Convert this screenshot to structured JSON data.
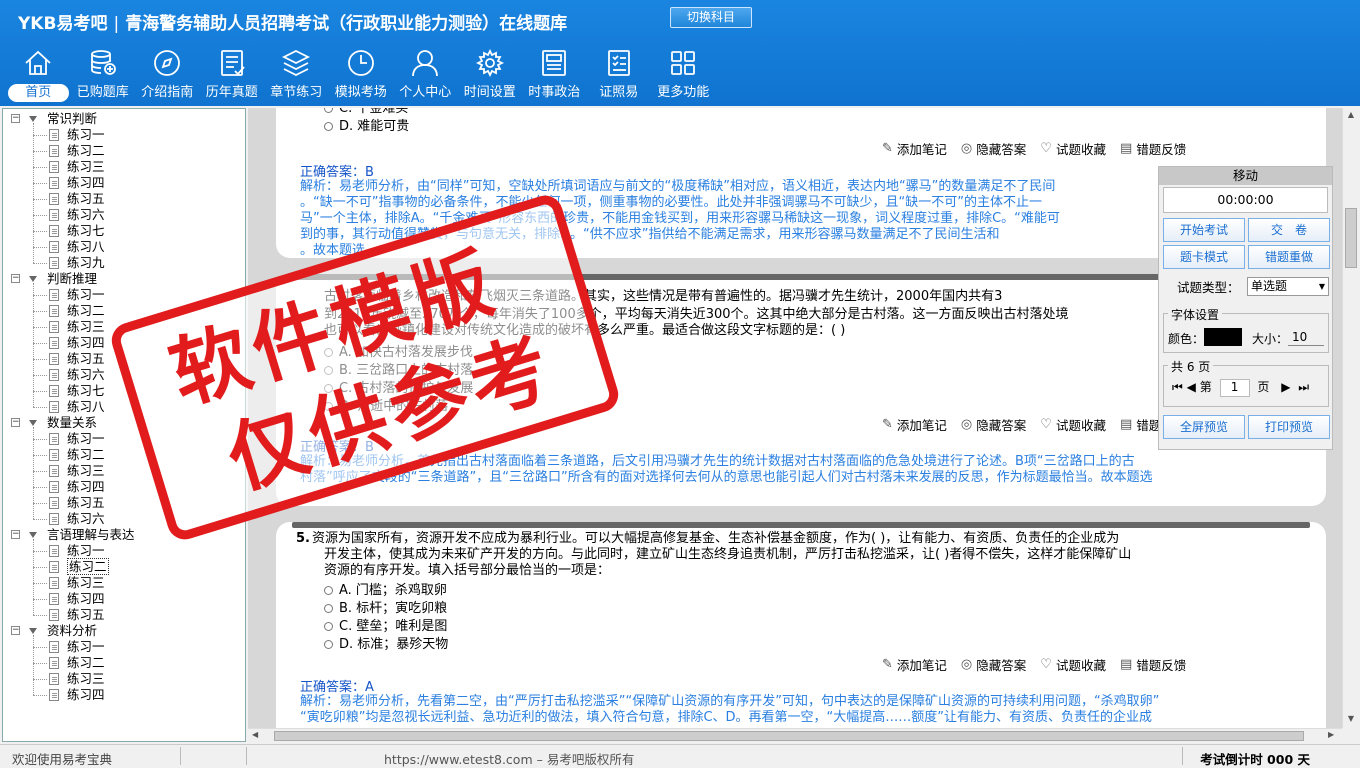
{
  "header": {
    "brand": "YKB易考吧",
    "separator": "|",
    "title": "青海警务辅助人员招聘考试（行政职业能力测验）在线题库",
    "switch_button": "切换科目"
  },
  "nav": [
    {
      "label": "首页",
      "icon": "home-icon",
      "active": true
    },
    {
      "label": "已购题库",
      "icon": "database-icon"
    },
    {
      "label": "介绍指南",
      "icon": "compass-icon"
    },
    {
      "label": "历年真题",
      "icon": "document-list-icon"
    },
    {
      "label": "章节练习",
      "icon": "layers-icon"
    },
    {
      "label": "模拟考场",
      "icon": "clock-icon"
    },
    {
      "label": "个人中心",
      "icon": "user-icon"
    },
    {
      "label": "时间设置",
      "icon": "gear-icon"
    },
    {
      "label": "时事政治",
      "icon": "newspaper-icon"
    },
    {
      "label": "证照易",
      "icon": "checklist-icon"
    },
    {
      "label": "更多功能",
      "icon": "grid-icon"
    }
  ],
  "tree": [
    {
      "label": "常识判断",
      "items": [
        "练习一",
        "练习二",
        "练习三",
        "练习四",
        "练习五",
        "练习六",
        "练习七",
        "练习八",
        "练习九"
      ]
    },
    {
      "label": "判断推理",
      "items": [
        "练习一",
        "练习二",
        "练习三",
        "练习四",
        "练习五",
        "练习六",
        "练习七",
        "练习八"
      ]
    },
    {
      "label": "数量关系",
      "items": [
        "练习一",
        "练习二",
        "练习三",
        "练习四",
        "练习五",
        "练习六"
      ]
    },
    {
      "label": "言语理解与表达",
      "items": [
        "练习一",
        "练习二",
        "练习三",
        "练习四",
        "练习五"
      ]
    },
    {
      "label": "资料分析",
      "items": [
        "练习一",
        "练习二",
        "练习三",
        "练习四"
      ]
    }
  ],
  "tree_selected": "练习二",
  "tools": {
    "note": "添加笔记",
    "hide": "隐藏答案",
    "favorite": "试题收藏",
    "feedback": "错题反馈"
  },
  "q3": {
    "opt_c": "C. 千金难买",
    "opt_d": "D. 难能可贵",
    "answer": "正确答案：B",
    "analysis": [
      "解析：易老师分析，由“同样”可知，空缺处所填词语应与前文的“极度稀缺”相对应，语义相近，表达内地“骡马”的数量满足不了民间",
      "。“缺一不可”指事物的必备条件，不能少任何一项，侧重事物的必要性。此处并非强调骡马不可缺少，且“缺一不可”的主体不止一",
      "马”一个主体，排除A。“千金难买”形容东西的珍贵，不能用金钱买到，用来形容骡马稀缺这一现象，词义程度过重，排除C。“难能可",
      "到的事，其行动值得赞赏，与句意无关，排除D。“供不应求”指供给不能满足需求，用来形容骡马数量满足不了民间生活和",
      "。故本题选"
    ]
  },
  "q4": {
    "text": [
      "古村落面临着乡村改造和灰飞烟灭三条道路。其实，这些情况是带有普遍性的。据冯骥才先生统计，2000年国内共有3",
      "到2010年锐减至270万个，每年消失了100多个，平均每天消失近300个。这其中绝大部分是古村落。这一方面反映出古村落处境",
      "也可以看出城镇化建设对传统文化造成的破坏有多么严重。最适合做这段文字标题的是：( )"
    ],
    "opt_a": "A. 加快古村落发展步伐",
    "opt_b": "B. 三岔路口上的古村落",
    "opt_c": "C. 古村落的保护与发展",
    "opt_d": "D. 消逝中的古村落",
    "answer": "正确答案：B",
    "analysis": [
      "解析：易老师分析，首先指出古村落面临着三条道路，后文引用冯骥才先生的统计数据对古村落面临的危急处境进行了论述。B项“三岔路口上的古",
      "村落”呼应了文段的“三条道路”，且“三岔路口”所含有的面对选择何去何从的意思也能引起人们对古村落未来发展的反思，作为标题最恰当。故本题选"
    ]
  },
  "q5": {
    "number": "5.",
    "text": [
      "资源为国家所有，资源开发不应成为暴利行业。可以大幅提高修复基金、生态补偿基金额度，作为( )，让有能力、有资质、负责任的企业成为",
      "开发主体，使其成为未来矿产开发的方向。与此同时，建立矿山生态终身追责机制，严厉打击私挖滥采，让( )者得不偿失，这样才能保障矿山",
      "资源的有序开发。填入括号部分最恰当的一项是："
    ],
    "opt_a": "A. 门槛；杀鸡取卵",
    "opt_b": "B. 标杆；寅吃卯粮",
    "opt_c": "C. 壁垒；唯利是图",
    "opt_d": "D. 标准；暴殄天物",
    "answer": "正确答案：A",
    "analysis": [
      "解析：易老师分析，先看第二空，由“严厉打击私挖滥采”“保障矿山资源的有序开发”可知，句中表达的是保障矿山资源的可持续利用问题，“杀鸡取卵”",
      "“寅吃卯粮”均是忽视长远利益、急功近利的做法，填入符合句意，排除C、D。再看第一空，“大幅提高……额度”让有能力、有资质、负责任的企业成"
    ]
  },
  "panel": {
    "title": "移动",
    "timer": "00:00:00",
    "start": "开始考试",
    "submit": "交　卷",
    "card_mode": "题卡模式",
    "redo": "错题重做",
    "type_label": "试题类型：",
    "type_value": "单选题",
    "font_group": "字体设置",
    "color_label": "颜色：",
    "size_label": "大小：",
    "size_value": "10",
    "color_value": "#000000",
    "pages": "共 6 页",
    "page_prefix": "第",
    "page_current": "1",
    "page_suffix": "页",
    "fullscreen": "全屏预览",
    "print": "打印预览"
  },
  "stamp": {
    "line1": "软件模版",
    "line2": "仅供参考"
  },
  "status": {
    "welcome": "欢迎使用易考宝典",
    "site": "https://www.etest8.com – 易考吧版权所有",
    "countdown": "考试倒计时 000 天"
  },
  "colors": {
    "header_blue": "#1581dc",
    "answer_blue": "#1555c8",
    "analysis_blue": "#2a7fe0",
    "stamp_red": "#e21c1c"
  }
}
